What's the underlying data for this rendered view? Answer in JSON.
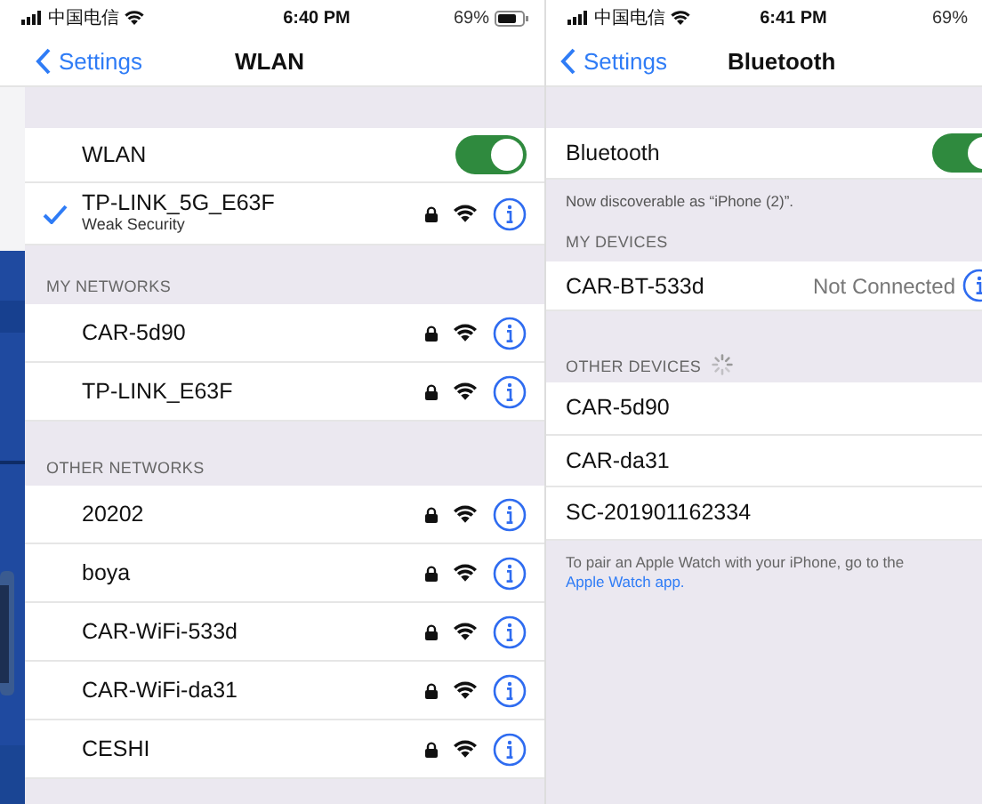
{
  "wlan_screen": {
    "status_bar": {
      "carrier": "中国电信",
      "time": "6:40 PM",
      "battery": "69%"
    },
    "nav": {
      "back": "Settings",
      "title": "WLAN"
    },
    "toggle": {
      "label": "WLAN",
      "on": true
    },
    "connected": {
      "name": "TP-LINK_5G_E63F",
      "detail": "Weak Security",
      "selected": true
    },
    "sections": [
      {
        "header": "MY NETWORKS",
        "networks": [
          {
            "name": "CAR-5d90"
          },
          {
            "name": "TP-LINK_E63F"
          }
        ]
      },
      {
        "header": "OTHER NETWORKS",
        "networks": [
          {
            "name": "20202"
          },
          {
            "name": "boya"
          },
          {
            "name": "CAR-WiFi-533d"
          },
          {
            "name": "CAR-WiFi-da31"
          },
          {
            "name": "CESHI"
          }
        ]
      }
    ]
  },
  "bluetooth_screen": {
    "status_bar": {
      "carrier": "中国电信",
      "time": "6:41 PM",
      "battery": "69%"
    },
    "nav": {
      "back": "Settings",
      "title": "Bluetooth"
    },
    "toggle": {
      "label": "Bluetooth",
      "on": true
    },
    "discoverable_note": "Now discoverable as “iPhone (2)”.",
    "my_devices": {
      "header": "MY DEVICES",
      "devices": [
        {
          "name": "CAR-BT-533d",
          "status": "Not Connected"
        }
      ]
    },
    "other_devices": {
      "header": "OTHER DEVICES",
      "searching": true,
      "devices": [
        {
          "name": "CAR-5d90"
        },
        {
          "name": "CAR-da31"
        },
        {
          "name": "SC-201901162334"
        }
      ]
    },
    "footer": {
      "text": "To pair an Apple Watch with your iPhone, go to the",
      "link": "Apple Watch app."
    }
  }
}
